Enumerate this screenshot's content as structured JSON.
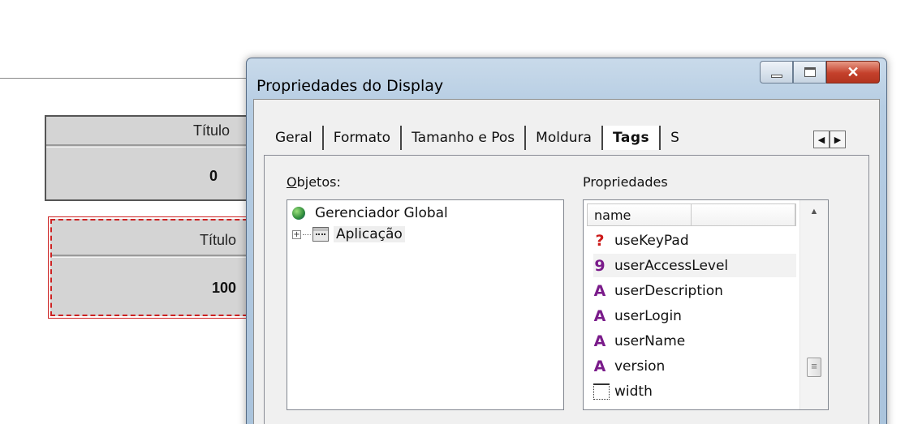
{
  "widgets": [
    {
      "title": "Título",
      "value": "0"
    },
    {
      "title": "Título",
      "value": "100"
    }
  ],
  "dialog": {
    "title": "Propriedades do Display",
    "tabs": [
      "Geral",
      "Formato",
      "Tamanho e Pos",
      "Moldura",
      "Tags",
      "S"
    ],
    "active_tab": "Tags",
    "objects_label_u": "O",
    "objects_label_rest": "bjetos:",
    "properties_label": "Propriedades",
    "tree": {
      "root": "Gerenciador Global",
      "child": "Aplicação",
      "expander": "+"
    },
    "props_header": {
      "col1": "name",
      "col2": ""
    },
    "props": [
      {
        "icon": "?",
        "type": "bool",
        "name": "useKeyPad"
      },
      {
        "icon": "9",
        "type": "int",
        "name": "userAccessLevel"
      },
      {
        "icon": "A",
        "type": "str",
        "name": "userDescription"
      },
      {
        "icon": "A",
        "type": "str",
        "name": "userLogin"
      },
      {
        "icon": "A",
        "type": "str",
        "name": "userName"
      },
      {
        "icon": "A",
        "type": "str",
        "name": "version"
      },
      {
        "icon": "width-icon",
        "type": "dim",
        "name": "width"
      }
    ]
  }
}
